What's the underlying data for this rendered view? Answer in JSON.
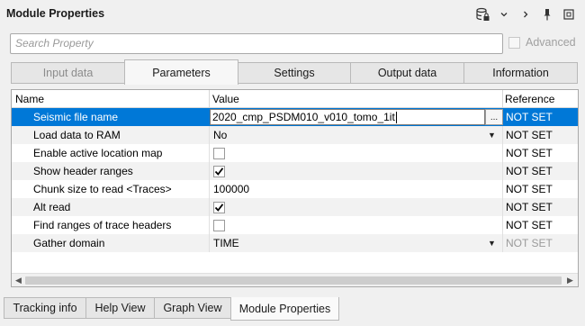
{
  "panel": {
    "title": "Module Properties"
  },
  "toolbar_icons": [
    "database-lock-icon",
    "chevron-down-icon",
    "chevron-right-icon",
    "pin-icon",
    "restore-icon"
  ],
  "search": {
    "placeholder": "Search Property",
    "value": ""
  },
  "advanced": {
    "label": "Advanced",
    "checked": false,
    "enabled": false
  },
  "tabs": [
    {
      "label": "Input data",
      "state": "disabled"
    },
    {
      "label": "Parameters",
      "state": "active"
    },
    {
      "label": "Settings",
      "state": "normal"
    },
    {
      "label": "Output data",
      "state": "normal"
    },
    {
      "label": "Information",
      "state": "normal"
    }
  ],
  "grid": {
    "columns": [
      "Name",
      "Value",
      "Reference"
    ],
    "rows": [
      {
        "name": "Seismic file name",
        "value": "2020_cmp_PSDM010_v010_tomo_1it",
        "type": "text-edit",
        "reference": "NOT SET",
        "selected": true,
        "button_label": "..."
      },
      {
        "name": "Load data to RAM",
        "value": "No",
        "type": "dropdown",
        "reference": "NOT SET"
      },
      {
        "name": "Enable active location map",
        "value": "",
        "type": "checkbox",
        "checked": false,
        "reference": "NOT SET"
      },
      {
        "name": "Show header ranges",
        "value": "",
        "type": "checkbox",
        "checked": true,
        "reference": "NOT SET"
      },
      {
        "name": "Chunk size to read <Traces>",
        "value": "100000",
        "type": "text",
        "reference": "NOT SET"
      },
      {
        "name": "Alt read",
        "value": "",
        "type": "checkbox",
        "checked": true,
        "reference": "NOT SET"
      },
      {
        "name": "Find ranges of trace headers",
        "value": "",
        "type": "checkbox",
        "checked": false,
        "reference": "NOT SET"
      },
      {
        "name": "Gather domain",
        "value": "TIME",
        "type": "dropdown",
        "reference": "NOT SET",
        "reference_dimmed": true
      }
    ]
  },
  "bottom_tabs": [
    {
      "label": "Tracking info",
      "active": false
    },
    {
      "label": "Help View",
      "active": false
    },
    {
      "label": "Graph View",
      "active": false
    },
    {
      "label": "Module Properties",
      "active": true
    }
  ],
  "colors": {
    "selection": "#0078d7",
    "row_alt": "#f2f2f2",
    "disabled_text": "#9a9a9a"
  }
}
